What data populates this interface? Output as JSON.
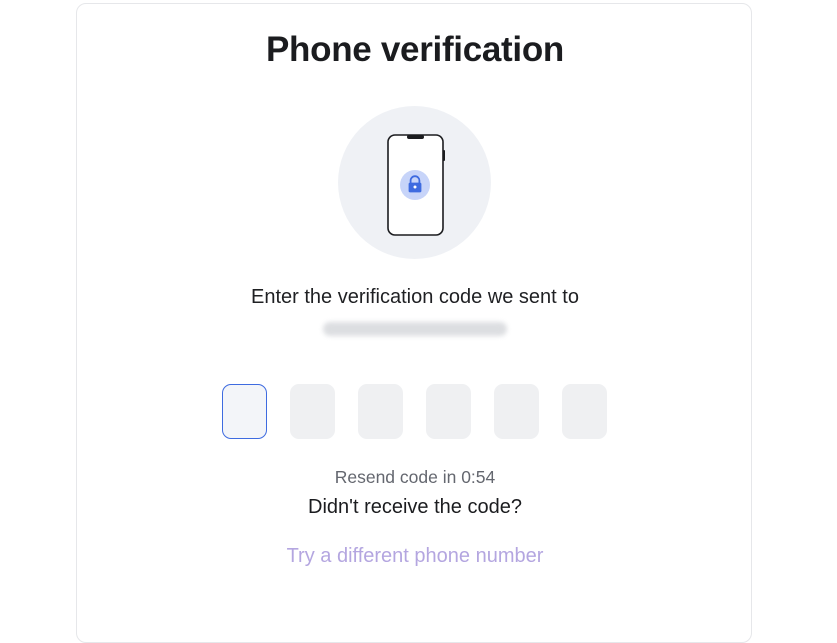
{
  "page": {
    "title": "Phone verification",
    "prompt": "Enter the verification code we sent to",
    "masked_phone_icon": "blurred-phone-number",
    "code": {
      "length": 6,
      "values": [
        "",
        "",
        "",
        "",
        "",
        ""
      ]
    },
    "resend_text": "Resend code in 0:54",
    "didnt_receive": "Didn't receive the code?",
    "try_different": "Try a different phone number"
  },
  "illustration": {
    "icon": "phone-lock-icon"
  },
  "colors": {
    "accent": "#3e6be0",
    "link": "#b4a6e0",
    "input_bg": "#eff0f2",
    "illustration_bg": "#eff1f5",
    "lock_badge": "#c7d4f9"
  }
}
